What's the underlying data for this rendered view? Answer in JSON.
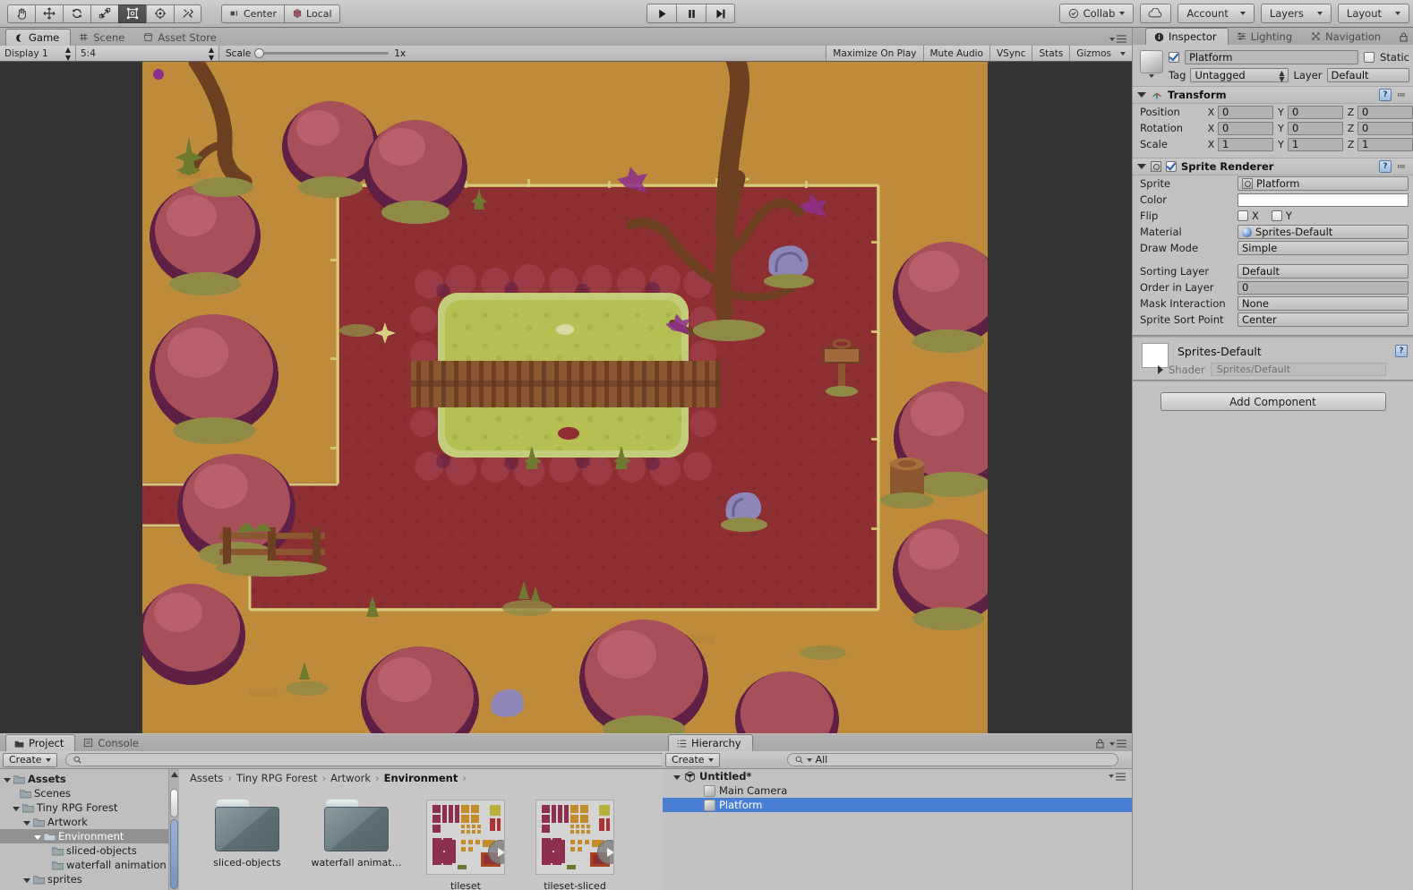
{
  "toolbar": {
    "tools": [
      {
        "name": "hand-tool",
        "glyph": "✋"
      },
      {
        "name": "move-tool",
        "glyph": "✥"
      },
      {
        "name": "rotate-tool",
        "glyph": "⟳"
      },
      {
        "name": "scale-tool",
        "glyph": "⤢"
      },
      {
        "name": "rect-tool",
        "glyph": "▣"
      },
      {
        "name": "transform-tool",
        "glyph": "◎"
      },
      {
        "name": "custom-tool",
        "glyph": "⚒"
      }
    ],
    "pivot_label": "Center",
    "space_label": "Local",
    "play_label": "▶",
    "pause_label": "❚❚",
    "step_label": "▶❙",
    "collab_label": "Collab",
    "account_label": "Account",
    "layers_label": "Layers",
    "layout_label": "Layout"
  },
  "game_panel": {
    "tabs": [
      {
        "label": "Game",
        "icon": "game-icon",
        "active": true
      },
      {
        "label": "Scene",
        "icon": "grid-icon",
        "active": false
      },
      {
        "label": "Asset Store",
        "icon": "store-icon",
        "active": false
      }
    ],
    "display": "Display 1",
    "aspect": "5:4",
    "scale_label": "Scale",
    "scale_value": "1x",
    "maximize_on_play": "Maximize On Play",
    "mute_audio": "Mute Audio",
    "vsync": "VSync",
    "stats": "Stats",
    "gizmos": "Gizmos"
  },
  "project_panel": {
    "tabs": [
      {
        "label": "Project",
        "icon": "folder-icon",
        "active": true
      },
      {
        "label": "Console",
        "icon": "console-icon",
        "active": false
      }
    ],
    "create_label": "Create",
    "search_placeholder": "",
    "breadcrumbs": [
      "Assets",
      "Tiny RPG Forest",
      "Artwork",
      "Environment"
    ],
    "tree": [
      {
        "label": "Assets",
        "depth": 0,
        "expanded": true,
        "bold": true,
        "selected": false
      },
      {
        "label": "Scenes",
        "depth": 1,
        "expanded": null,
        "bold": false,
        "selected": false
      },
      {
        "label": "Tiny RPG Forest",
        "depth": 1,
        "expanded": true,
        "bold": false,
        "selected": false
      },
      {
        "label": "Artwork",
        "depth": 2,
        "expanded": true,
        "bold": false,
        "selected": false
      },
      {
        "label": "Environment",
        "depth": 3,
        "expanded": true,
        "bold": false,
        "selected": true
      },
      {
        "label": "sliced-objects",
        "depth": 4,
        "expanded": null,
        "bold": false,
        "selected": false
      },
      {
        "label": "waterfall animation",
        "depth": 4,
        "expanded": null,
        "bold": false,
        "selected": false
      },
      {
        "label": "sprites",
        "depth": 2,
        "expanded": true,
        "bold": false,
        "selected": false
      }
    ],
    "items": [
      {
        "label": "sliced-objects",
        "type": "folder"
      },
      {
        "label": "waterfall animat…",
        "type": "folder"
      },
      {
        "label": "tileset",
        "type": "sprite"
      },
      {
        "label": "tileset-sliced",
        "type": "sprite"
      }
    ]
  },
  "hierarchy": {
    "tab_label": "Hierarchy",
    "create_label": "Create",
    "search_value": "All",
    "scene_name": "Untitled*",
    "objects": [
      {
        "label": "Main Camera",
        "selected": false
      },
      {
        "label": "Platform",
        "selected": true
      }
    ]
  },
  "inspector": {
    "tabs": [
      {
        "label": "Inspector",
        "icon": "info-icon",
        "active": true
      },
      {
        "label": "Lighting",
        "icon": "lighting-icon",
        "active": false
      },
      {
        "label": "Navigation",
        "icon": "navigation-icon",
        "active": false
      }
    ],
    "object_name": "Platform",
    "object_enabled": true,
    "static_label": "Static",
    "static_checked": false,
    "tag_label": "Tag",
    "tag_value": "Untagged",
    "layer_label": "Layer",
    "layer_value": "Default",
    "transform": {
      "title": "Transform",
      "position_label": "Position",
      "rotation_label": "Rotation",
      "scale_label": "Scale",
      "position": {
        "x": "0",
        "y": "0",
        "z": "0"
      },
      "rotation": {
        "x": "0",
        "y": "0",
        "z": "0"
      },
      "scale": {
        "x": "1",
        "y": "1",
        "z": "1"
      },
      "axis_x": "X",
      "axis_y": "Y",
      "axis_z": "Z"
    },
    "sprite_renderer": {
      "title": "Sprite Renderer",
      "enabled": true,
      "sprite_label": "Sprite",
      "sprite_value": "Platform",
      "color_label": "Color",
      "color_value": "#FFFFFF",
      "flip_label": "Flip",
      "flip_x_label": "X",
      "flip_y_label": "Y",
      "material_label": "Material",
      "material_value": "Sprites-Default",
      "draw_mode_label": "Draw Mode",
      "draw_mode_value": "Simple",
      "sorting_layer_label": "Sorting Layer",
      "sorting_layer_value": "Default",
      "order_in_layer_label": "Order in Layer",
      "order_in_layer_value": "0",
      "mask_interaction_label": "Mask Interaction",
      "mask_interaction_value": "None",
      "sprite_sort_point_label": "Sprite Sort Point",
      "sprite_sort_point_value": "Center"
    },
    "material": {
      "name": "Sprites-Default",
      "shader_label": "Shader",
      "shader_value": "Sprites/Default"
    },
    "add_component_label": "Add Component"
  },
  "colors": {
    "chrome": "#c2c2c2",
    "selection_blue": "#4b7fd4",
    "tree_selection": "#919191",
    "game_bg": "#333333",
    "ground": "#bd8b3a",
    "path": "#8e2f33",
    "grass": "#b5bf52",
    "tree_canopy": "#a8505a",
    "tree_shadow": "#5e2044",
    "fence": "#7a4a2c",
    "dry_grass": "#d6cf7f"
  }
}
